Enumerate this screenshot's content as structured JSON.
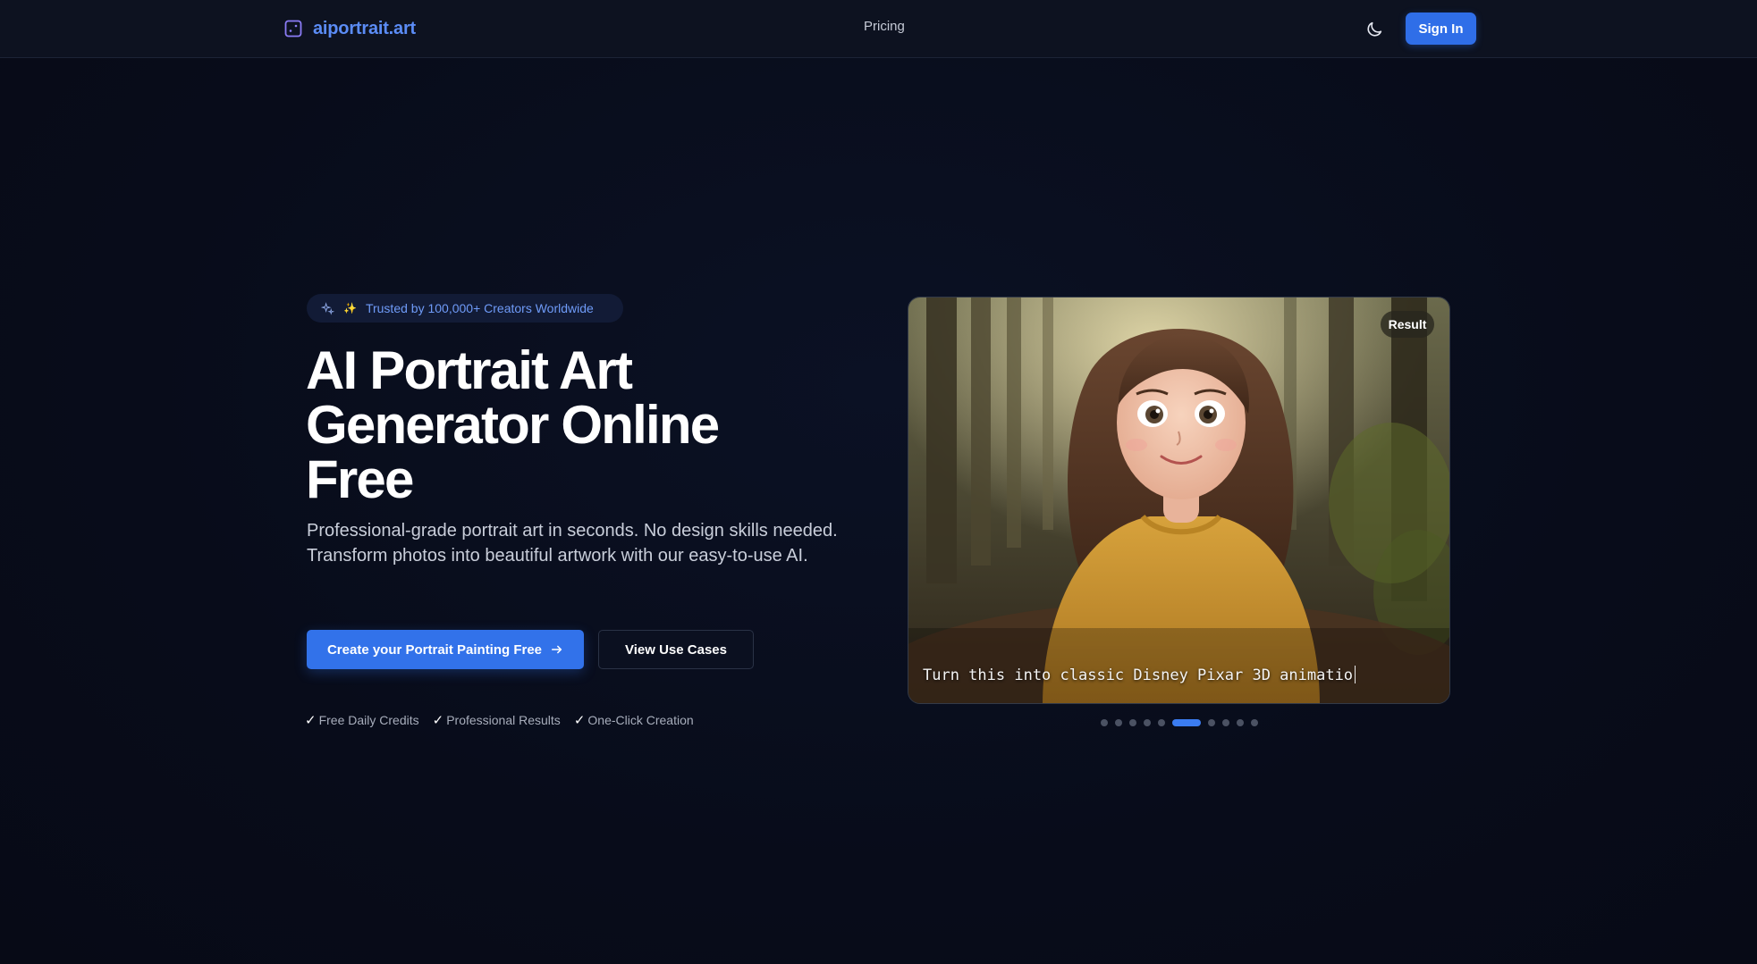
{
  "nav": {
    "brand": "aiportrait.art",
    "brand_icon": "sparkle-square-icon",
    "links": [
      {
        "label": "Pricing"
      }
    ],
    "theme_icon": "moon-icon",
    "signin_label": "Sign In"
  },
  "hero": {
    "badge_icon": "sparkles-icon",
    "badge_star": "✨",
    "badge_text": "Trusted by 100,000+ Creators Worldwide",
    "title_line1": "AI Portrait Art",
    "title_line2": "Generator Online",
    "title_line3": "Free",
    "subtitle": "Professional-grade portrait art in seconds. No design skills needed. Transform photos into beautiful artwork with our easy-to-use AI.",
    "primary_cta": "Create your Portrait Painting Free",
    "primary_cta_icon": "arrow-right-icon",
    "secondary_cta": "View Use Cases",
    "features": [
      {
        "check": "✓",
        "label": "Free Daily Credits"
      },
      {
        "check": "✓",
        "label": "Professional Results"
      },
      {
        "check": "✓",
        "label": "One-Click Creation"
      }
    ]
  },
  "showcase": {
    "result_label": "Result",
    "prompt_text": "Turn this into classic Disney Pixar 3D animatio",
    "carousel": {
      "total": 10,
      "active_index": 5
    }
  },
  "colors": {
    "accent": "#3272ea",
    "brand_text": "#5b8cf6",
    "background": "#080c1a"
  }
}
